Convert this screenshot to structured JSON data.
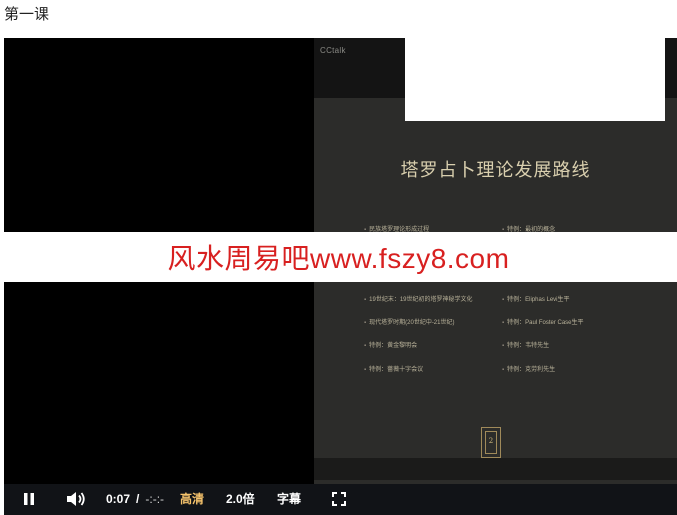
{
  "page": {
    "title": "第一课"
  },
  "slide": {
    "brand": "CCtalk",
    "title": "塔罗占卜理论发展路线",
    "items": [
      {
        "text": "民族塔罗理论形成过程"
      },
      {
        "text": "特例：最初的概念"
      },
      {
        "text": "19世纪末：19世纪初的塔罗神秘学文化"
      },
      {
        "text": "特例：Eliphas Levi生平"
      },
      {
        "text": "现代塔罗时期(20世纪中-21世纪)"
      },
      {
        "text": "特例：Paul Foster Case生平"
      },
      {
        "text": "特例：黄金黎明会"
      },
      {
        "text": "特例：韦特先生"
      },
      {
        "text": "特例：蔷薇十字会议"
      },
      {
        "text": "特例：克劳利先生"
      }
    ],
    "emblem_number": "2"
  },
  "watermark": {
    "text": "风水周易吧www.fszy8.com"
  },
  "controls": {
    "pause_icon": "pause-icon",
    "volume_icon": "volume-icon",
    "current_time": "0:07",
    "time_separator": "/",
    "duration": "-:-:-",
    "quality_label": "高清",
    "speed_label": "2.0倍",
    "subtitle_label": "字幕",
    "fullscreen_icon": "fullscreen-icon",
    "quality_color": "#f5c26b"
  }
}
